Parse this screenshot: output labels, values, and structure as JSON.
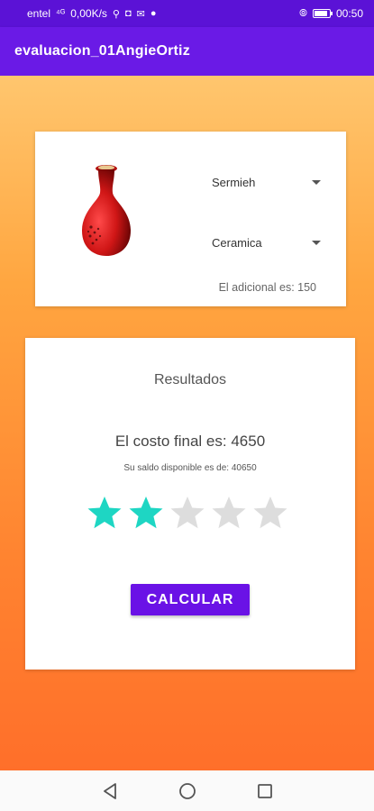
{
  "status_bar": {
    "carrier": "entel",
    "network": "⁴ᴳ",
    "speed": "0,00K/s",
    "time": "00:50",
    "icons": [
      "usb-icon",
      "instagram-icon",
      "message-icon",
      "whatsapp-icon",
      "vibrate-icon",
      "battery-icon"
    ]
  },
  "app_bar": {
    "title": "evaluacion_01AngieOrtiz"
  },
  "product_card": {
    "image_icon": "vase-icon",
    "vase_dropdown": {
      "selected": "Sermieh"
    },
    "material_dropdown": {
      "selected": "Ceramica"
    },
    "adicional_text": "El adicional es: 150"
  },
  "results_card": {
    "title": "Resultados",
    "costo_text": "El costo final es: 4650",
    "saldo_text": "Su saldo disponible es de: 40650",
    "rating": {
      "value": 2,
      "max": 5
    },
    "calcular_label": "CALCULAR"
  },
  "colors": {
    "app_bar": "#6a1ae6",
    "status_bar": "#5b12d6",
    "button": "#6a12e6",
    "star_filled": "#1ed6c3",
    "star_empty": "#dddddd",
    "gradient_top": "#ffc66e",
    "gradient_bottom": "#ff6f2a"
  },
  "nav_bar": {
    "icons": [
      "back-icon",
      "home-icon",
      "recents-icon"
    ]
  }
}
